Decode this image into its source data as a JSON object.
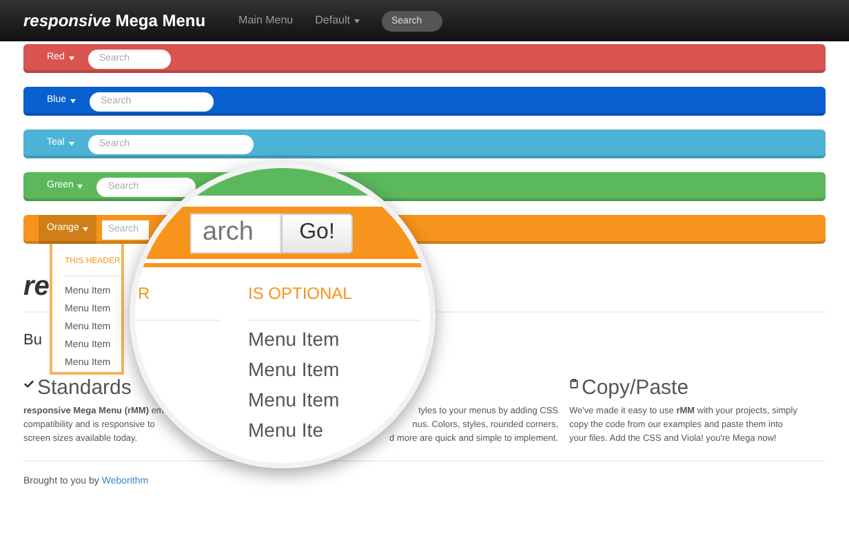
{
  "navbar": {
    "brand": "*responsive* Mega Menu",
    "links": [
      {
        "label": "Main Menu",
        "kind": "link"
      },
      {
        "label": "Default",
        "kind": "dropdown"
      }
    ],
    "search": {
      "placeholder": "Search"
    }
  },
  "menus": [
    {
      "label": "Red",
      "color": "#d9534f",
      "open": false,
      "search": {
        "placeholder": "Search"
      }
    },
    {
      "label": "Blue",
      "color": "#0a5fd1",
      "open": false,
      "search": {
        "placeholder": "Search"
      }
    },
    {
      "label": "Teal",
      "color": "#4cb3d6",
      "open": false,
      "search": {
        "placeholder": "Search"
      }
    },
    {
      "label": "Green",
      "color": "#5cb85c",
      "open": false,
      "search": {
        "placeholder": "Search"
      }
    },
    {
      "label": "Orange",
      "color": "#f7941d",
      "open": true,
      "search": {
        "placeholder": "Search"
      }
    }
  ],
  "dropdown": {
    "header": "THIS HEADER",
    "items": [
      "Menu Item",
      "Menu Item",
      "Menu Item",
      "Menu Item",
      "Menu Item"
    ]
  },
  "heading": "re",
  "subheading": "Bu",
  "features": [
    {
      "title": "Standards",
      "lines": [
        "**responsive Mega Menu (rMM)** em",
        "compatibility and is responsive to",
        "screen sizes available today."
      ]
    },
    {
      "lines": [
        "tyles to your menus by adding CSS",
        "nus. Colors, styles, rounded corners,",
        "d more are quick and simple to implement."
      ]
    },
    {
      "title": "Copy/Paste",
      "lines": [
        "We've made it easy to use **rMM** with your projects, simply",
        "copy the code from our examples and paste them into",
        "your files. Add the CSS and Viola! you're Mega now!"
      ]
    }
  ],
  "footer": {
    "text": "Brought to you by",
    "link": "Weborithm"
  },
  "magnifier": {
    "search": {
      "placeholder": "arch"
    },
    "button": "Go!",
    "headers": [
      "R",
      "IS OPTIONAL"
    ],
    "items": [
      "Menu Item",
      "Menu Item",
      "Menu Item",
      "Menu Ite"
    ]
  }
}
